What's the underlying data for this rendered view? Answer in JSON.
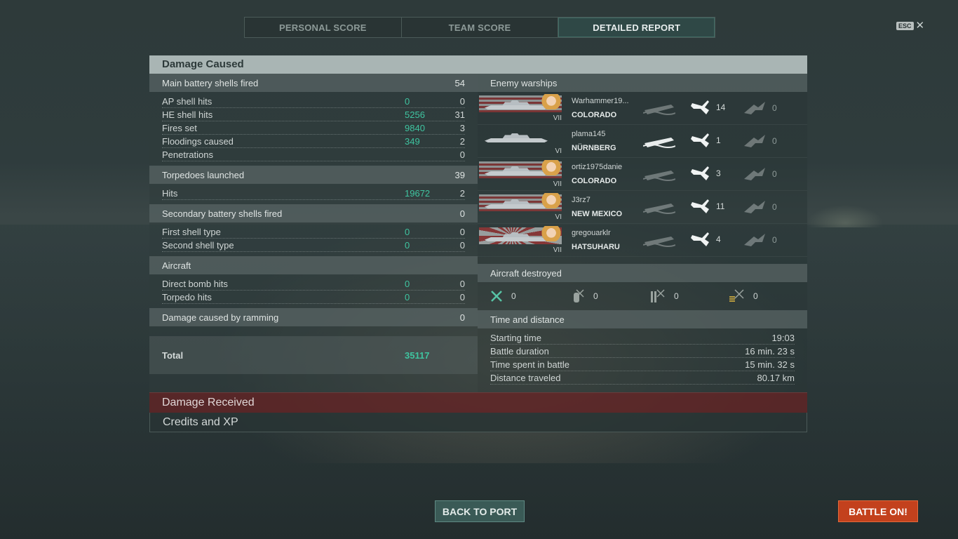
{
  "tabs": [
    {
      "label": "PERSONAL SCORE",
      "active": false
    },
    {
      "label": "TEAM SCORE",
      "active": false
    },
    {
      "label": "DETAILED REPORT",
      "active": true
    }
  ],
  "esc": {
    "key": "ESC",
    "close": "✕"
  },
  "damage_caused": {
    "title": "Damage Caused",
    "main_battery": {
      "header": {
        "label": "Main battery shells fired",
        "count": "54"
      },
      "rows": [
        {
          "label": "AP shell hits",
          "damage": "0",
          "count": "0"
        },
        {
          "label": "HE shell hits",
          "damage": "5256",
          "count": "31"
        },
        {
          "label": "Fires set",
          "damage": "9840",
          "count": "3"
        },
        {
          "label": "Floodings caused",
          "damage": "349",
          "count": "2"
        },
        {
          "label": "Penetrations",
          "damage": "",
          "count": "0"
        }
      ]
    },
    "torpedoes": {
      "header": {
        "label": "Torpedoes launched",
        "count": "39"
      },
      "rows": [
        {
          "label": "Hits",
          "damage": "19672",
          "count": "2"
        }
      ]
    },
    "secondary": {
      "header": {
        "label": "Secondary battery shells fired",
        "count": "0"
      },
      "rows": [
        {
          "label": "First shell type",
          "damage": "0",
          "count": "0"
        },
        {
          "label": "Second shell type",
          "damage": "0",
          "count": "0"
        }
      ]
    },
    "aircraft": {
      "header": {
        "label": "Aircraft",
        "count": ""
      },
      "rows": [
        {
          "label": "Direct bomb hits",
          "damage": "0",
          "count": "0"
        },
        {
          "label": "Torpedo hits",
          "damage": "0",
          "count": "0"
        }
      ]
    },
    "ramming": {
      "label": "Damage caused by ramming",
      "count": "0"
    },
    "total": {
      "label": "Total",
      "damage": "35117"
    }
  },
  "enemy_warships": {
    "title": "Enemy warships",
    "ships": [
      {
        "player": "Warhammer19...",
        "ship": "COLORADO",
        "tier": "VII",
        "sunk": false,
        "spotted": "14",
        "buildings": "0"
      },
      {
        "player": "plama145",
        "ship": "NÜRNBERG",
        "tier": "VI",
        "sunk": true,
        "spotted": "1",
        "buildings": "0"
      },
      {
        "player": "ortiz1975danie",
        "ship": "COLORADO",
        "tier": "VII",
        "sunk": false,
        "spotted": "3",
        "buildings": "0"
      },
      {
        "player": "J3rz7",
        "ship": "NEW MEXICO",
        "tier": "VI",
        "sunk": false,
        "spotted": "11",
        "buildings": "0"
      },
      {
        "player": "gregouarklr",
        "ship": "HATSUHARU",
        "tier": "VII",
        "sunk": false,
        "spotted": "4",
        "buildings": "0"
      }
    ]
  },
  "aircraft_destroyed": {
    "title": "Aircraft destroyed",
    "items": [
      {
        "icon": "fighter-icon",
        "value": "0"
      },
      {
        "icon": "bomb-icon",
        "value": "0"
      },
      {
        "icon": "torpedo-bomber-icon",
        "value": "0"
      },
      {
        "icon": "dive-bomber-icon",
        "value": "0"
      }
    ]
  },
  "time_distance": {
    "title": "Time and distance",
    "rows": [
      {
        "label": "Starting time",
        "value": "19:03"
      },
      {
        "label": "Battle duration",
        "value": "16 min. 23 s"
      },
      {
        "label": "Time spent in battle",
        "value": "15 min. 32 s"
      },
      {
        "label": "Distance traveled",
        "value": "80.17 km"
      }
    ]
  },
  "collapsed": {
    "damage_received": "Damage Received",
    "credits_xp": "Credits and XP"
  },
  "buttons": {
    "back_to_port": "BACK TO PORT",
    "battle_on": "BATTLE ON!"
  },
  "colors": {
    "damage_value": "#3fc4a0",
    "battle_button": "#c3411d",
    "received_bar": "#5f2426"
  }
}
